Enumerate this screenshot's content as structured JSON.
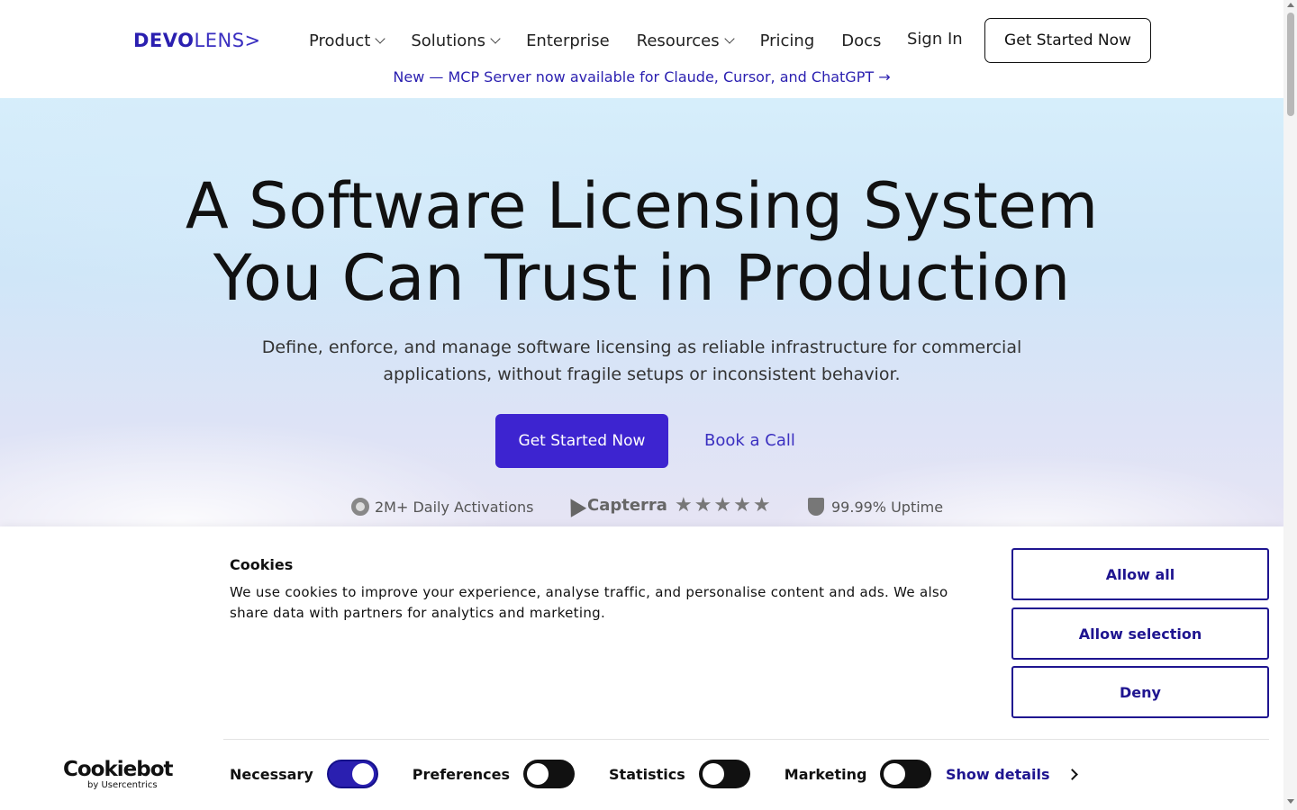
{
  "header": {
    "logo_bold": "DEVO",
    "logo_light": "LENS>",
    "nav": [
      {
        "label": "Product",
        "has_dropdown": true
      },
      {
        "label": "Solutions",
        "has_dropdown": true
      },
      {
        "label": "Enterprise",
        "has_dropdown": false
      },
      {
        "label": "Resources",
        "has_dropdown": true
      },
      {
        "label": "Pricing",
        "has_dropdown": false
      },
      {
        "label": "Docs",
        "has_dropdown": false
      }
    ],
    "sign_in": "Sign In",
    "cta": "Get Started Now",
    "announcement": "New — MCP Server now available for Claude, Cursor, and ChatGPT →"
  },
  "hero": {
    "title_line1": "A Software Licensing System",
    "title_line2": "You Can Trust in Production",
    "subtitle": "Define, enforce, and manage software licensing as reliable infrastructure for commercial applications, without fragile setups or inconsistent behavior.",
    "primary_cta": "Get Started Now",
    "secondary_cta": "Book a Call",
    "badges": {
      "activations": "2M+ Daily Activations",
      "capterra": "Capterra",
      "stars": "★★★★★",
      "uptime": "99.99% Uptime"
    }
  },
  "cookie_banner": {
    "title": "Cookies",
    "text": "We use cookies to improve your experience, analyse traffic, and personalise content and ads. We also share data with partners for analytics and marketing.",
    "allow_all": "Allow all",
    "allow_selection": "Allow selection",
    "deny": "Deny",
    "brand_main": "Cookiebot",
    "brand_sub": "by Usercentrics",
    "toggles": [
      {
        "label": "Necessary",
        "on": true
      },
      {
        "label": "Preferences",
        "on": false
      },
      {
        "label": "Statistics",
        "on": false
      },
      {
        "label": "Marketing",
        "on": false
      }
    ],
    "show_details": "Show details"
  },
  "colors": {
    "brand": "#3d24d0",
    "link": "#2a1fb0",
    "cookie_accent": "#1f1590"
  }
}
